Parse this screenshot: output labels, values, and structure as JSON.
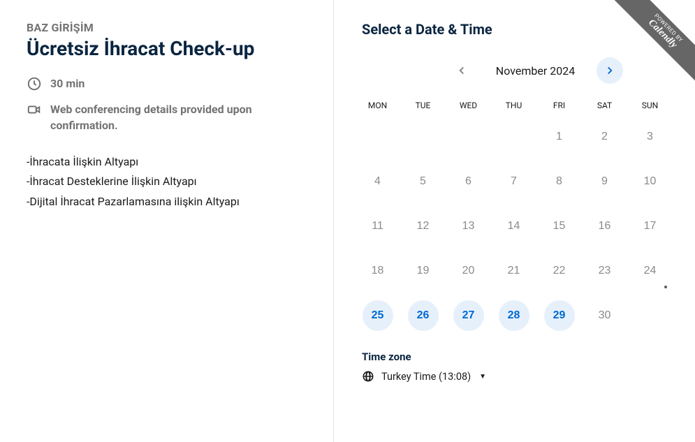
{
  "left": {
    "organizer": "BAZ GİRİŞİM",
    "title": "Ücretsiz İhracat Check-up",
    "duration": "30 min",
    "conferencing": "Web conferencing details provided upon confirmation.",
    "description_lines": [
      "-İhracata İlişkin Altyapı",
      "-İhracat Destekler­ine İlişkin Altyapı",
      "-Dijital İhracat Pazarlamasına ilişkin Altyapı"
    ]
  },
  "right": {
    "heading": "Select a Date & Time",
    "month_label": "November 2024",
    "weekdays": [
      "MON",
      "TUE",
      "WED",
      "THU",
      "FRI",
      "SAT",
      "SUN"
    ],
    "blanks_before": 4,
    "days_in_month": 30,
    "today": 24,
    "available_days": [
      25,
      26,
      27,
      28,
      29
    ],
    "timezone_label": "Time zone",
    "timezone_value": "Turkey Time (13:08)"
  },
  "ribbon": {
    "small": "POWERED BY",
    "brand": "Calendly"
  }
}
